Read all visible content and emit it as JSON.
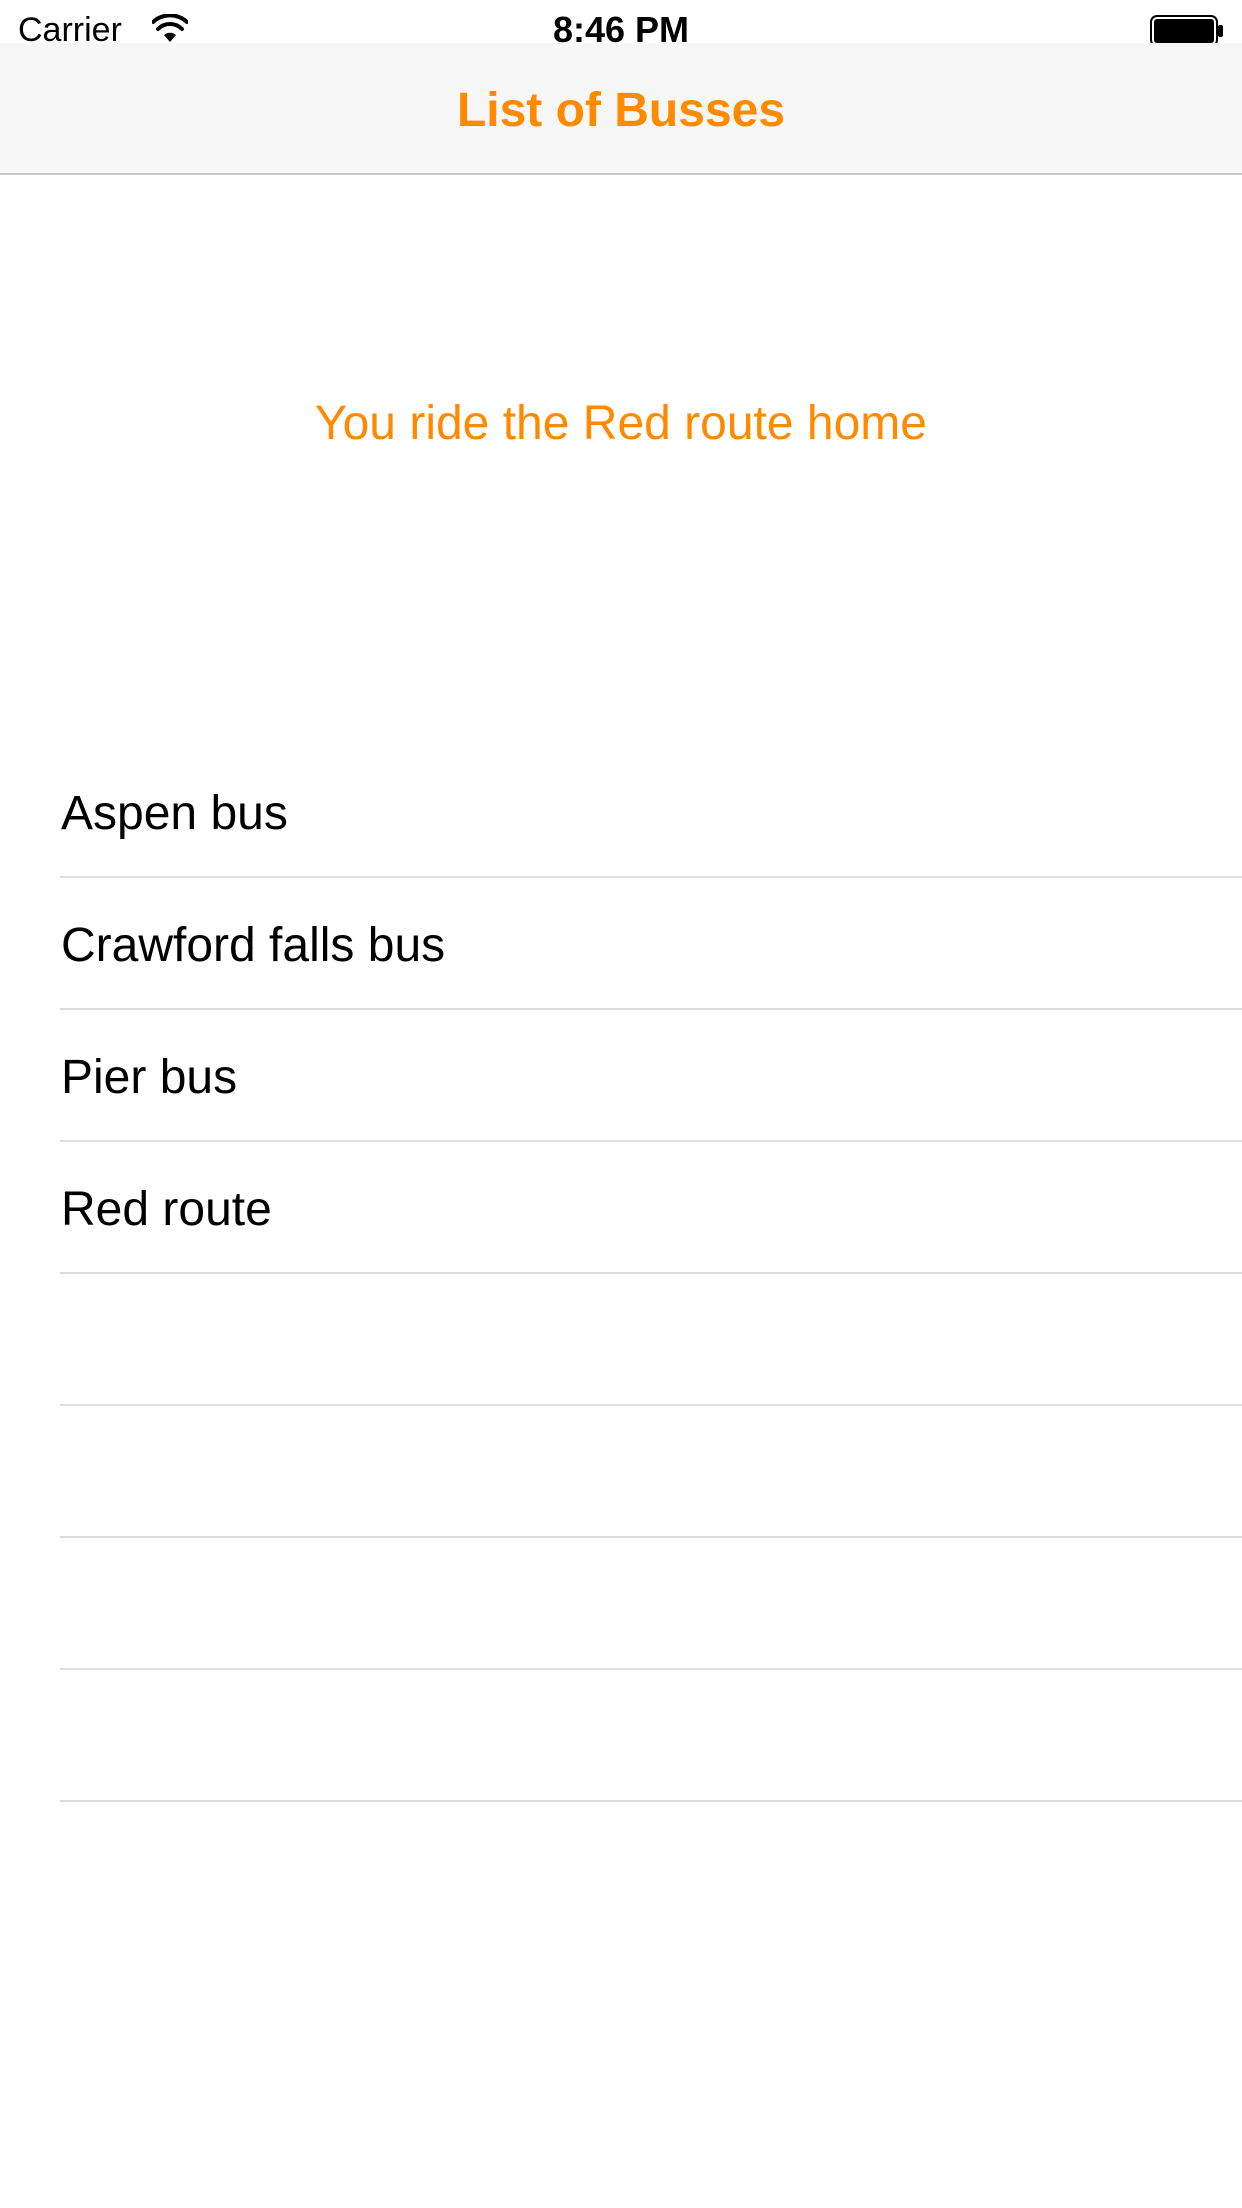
{
  "colors": {
    "accent": "#ff8a00",
    "text": "#000000",
    "nav_background": "#f7f7f7",
    "separator": "#dcdcde"
  },
  "status_bar": {
    "carrier": "Carrier",
    "time": "8:46 PM",
    "icons": [
      "wifi-icon",
      "battery-icon"
    ]
  },
  "nav_bar": {
    "title": "List of Busses"
  },
  "message": "You ride the Red route home",
  "bus_list": {
    "items": [
      {
        "label": "Aspen bus"
      },
      {
        "label": "Crawford falls bus"
      },
      {
        "label": "Pier bus"
      },
      {
        "label": "Red route"
      },
      {
        "label": ""
      },
      {
        "label": ""
      },
      {
        "label": ""
      },
      {
        "label": ""
      }
    ]
  }
}
